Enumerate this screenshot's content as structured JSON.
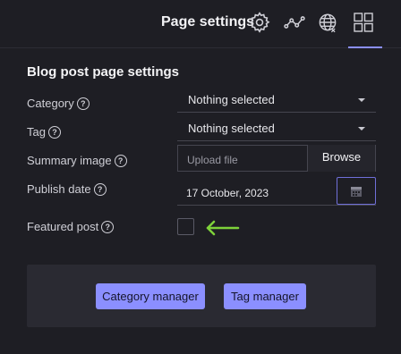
{
  "header": {
    "title": "Page settings",
    "icons": [
      "gear-icon",
      "route-icon",
      "globe-icon",
      "grid-icon"
    ],
    "accent_color": "#8b8fff"
  },
  "form": {
    "section_title": "Blog post page settings",
    "category": {
      "label": "Category",
      "value": "Nothing selected"
    },
    "tag": {
      "label": "Tag",
      "value": "Nothing selected"
    },
    "summary_image": {
      "label": "Summary image",
      "placeholder": "Upload file",
      "browse_label": "Browse"
    },
    "publish_date": {
      "label": "Publish date",
      "value": "17 October, 2023"
    },
    "featured_post": {
      "label": "Featured post",
      "checked": false
    },
    "help_glyph": "?"
  },
  "footer": {
    "category_manager_label": "Category manager",
    "tag_manager_label": "Tag manager"
  }
}
